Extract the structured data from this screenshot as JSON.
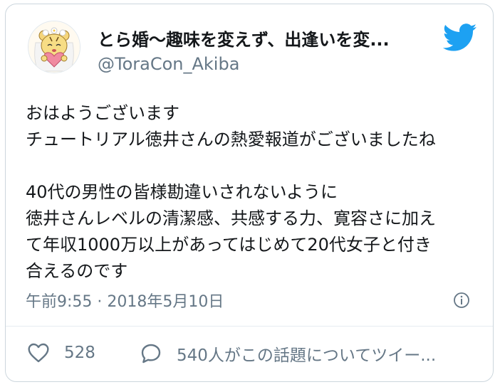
{
  "author": {
    "name": "とら婚〜趣味を変えず、出逢いを変...",
    "handle": "@ToraCon_Akiba"
  },
  "tweet": {
    "lines": [
      "おはようございます",
      "チュートリアル徳井さんの熱愛報道がございましたね",
      "",
      "40代の男性の皆様勘違いされないように",
      "徳井さんレベルの清潔感、共感する力、寛容さに加え",
      "て年収1000万以上があってはじめて20代女子と付き",
      "合えるのです"
    ],
    "timestamp": "午前9:55 · 2018年5月10日"
  },
  "actions": {
    "likes": "528",
    "replies_label": "540人がこの話題についてツイー..."
  },
  "icons": {
    "brand": "twitter-bird-icon",
    "info": "info-icon",
    "like": "heart-icon",
    "reply": "speech-bubble-icon"
  },
  "colors": {
    "twitter_blue": "#1da1f2",
    "secondary_text": "#657786",
    "border": "#ccd6dd"
  }
}
